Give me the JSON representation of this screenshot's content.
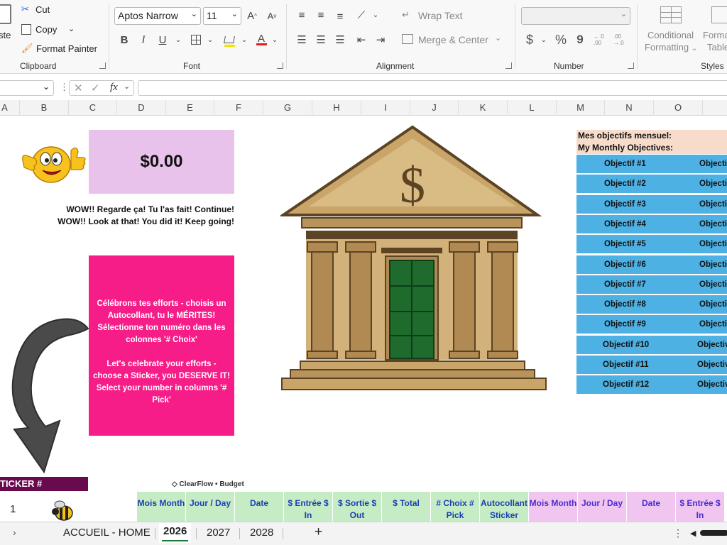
{
  "ribbon": {
    "clipboard": {
      "paste": "Paste",
      "paste_visible": "ste",
      "cut": "Cut",
      "copy": "Copy",
      "format_painter": "Format Painter",
      "label": "Clipboard"
    },
    "font": {
      "family": "Aptos Narrow",
      "size": "11",
      "label": "Font",
      "grow": "A",
      "shrink": "A",
      "bold": "B",
      "italic": "I",
      "underline": "U",
      "color_glyph": "A",
      "fill_color": "#f5e400",
      "font_color": "#e02020"
    },
    "alignment": {
      "wrap_text": "Wrap Text",
      "merge_center": "Merge & Center",
      "label": "Alignment"
    },
    "number": {
      "format": "",
      "currency": "$",
      "percent": "%",
      "comma": "9",
      "inc_dec": "←.0 .00",
      "dec_dec": ".00 →.0",
      "label": "Number"
    },
    "styles": {
      "conditional_1": "Conditional",
      "conditional_2": "Formatting",
      "format_table_1": "Forma",
      "format_table_2": "Table",
      "label": "Styles"
    }
  },
  "formula_bar": {
    "name_box": "",
    "fx": "fx",
    "value": ""
  },
  "columns": [
    "A",
    "B",
    "C",
    "D",
    "E",
    "F",
    "G",
    "H",
    "I",
    "J",
    "K",
    "L",
    "M",
    "N",
    "O"
  ],
  "sheet": {
    "amount": "$0.00",
    "wow_fr": "WOW!! Regarde ça! Tu l'as fait! Continue!",
    "wow_en": "WOW!! Look at that! You did it! Keep going!",
    "celebrate_fr": "Célébrons tes efforts - choisis un Autocollant, tu le MÉRITES! Sélectionne ton numéro dans les colonnes '# Choix'",
    "celebrate_en": "Let's celebrate your efforts - choose a Sticker, you DESERVE IT! Select your number in columns '# Pick'",
    "bank_dollar": "$",
    "objectives_title_fr": "Mes objectifs mensuel:",
    "objectives_title_en": "My Monthly Objectives:",
    "objectives": [
      "Objectif #1",
      "Objectif #2",
      "Objectif #3",
      "Objectif #4",
      "Objectif #5",
      "Objectif #6",
      "Objectif #7",
      "Objectif #8",
      "Objectif #9",
      "Objectif #10",
      "Objectif #11",
      "Objectif #12"
    ],
    "objectives_col2": [
      "Objecti",
      "Objecti",
      "Objecti",
      "Objecti",
      "Objecti",
      "Objecti",
      "Objecti",
      "Objecti",
      "Objecti",
      "Objectiv",
      "Objectiv",
      "Objectiv"
    ],
    "sticker_header": "TICKER #",
    "clearflow": "ClearFlow • Budget",
    "first_row_number": "1",
    "table_headers_green": [
      "Mois Month",
      "Jour / Day",
      "Date",
      "$ Entrée $ In",
      "$ Sortie $ Out",
      "$ Total",
      "# Choix # Pick",
      "Autocollant Sticker"
    ],
    "table_headers_pink": [
      "Mois Month",
      "Jour / Day",
      "Date",
      "$ Entrée $ In"
    ]
  },
  "tabs": {
    "items": [
      "ACCUEIL - HOME",
      "2026",
      "2027",
      "2028"
    ],
    "active": "2026",
    "add": "+"
  },
  "colors": {
    "pink_box": "#f71d88",
    "amount_box": "#e9c2ec",
    "objective_blue": "#4db1e3",
    "objective_header": "#f8dccb",
    "sticker_header": "#6a0a4e"
  }
}
